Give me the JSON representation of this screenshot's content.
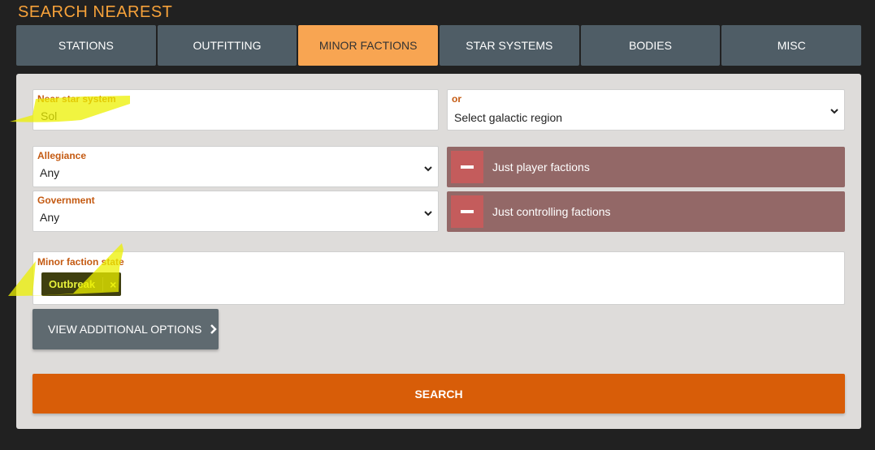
{
  "page": {
    "title": "SEARCH NEAREST"
  },
  "tabs": [
    {
      "label": "STATIONS",
      "active": false
    },
    {
      "label": "OUTFITTING",
      "active": false
    },
    {
      "label": "MINOR FACTIONS",
      "active": true
    },
    {
      "label": "STAR SYSTEMS",
      "active": false
    },
    {
      "label": "BODIES",
      "active": false
    },
    {
      "label": "MISC",
      "active": false
    }
  ],
  "form": {
    "near_system": {
      "label": "Near star system",
      "value": "Sol"
    },
    "region": {
      "label": "or",
      "value": "Select galactic region"
    },
    "allegiance": {
      "label": "Allegiance",
      "value": "Any"
    },
    "government": {
      "label": "Government",
      "value": "Any"
    },
    "player_factions": {
      "label": "Just player factions",
      "state": "off"
    },
    "controlling_factions": {
      "label": "Just controlling factions",
      "state": "off"
    },
    "faction_state": {
      "label": "Minor faction state",
      "tags": [
        "Outbreak"
      ],
      "remove_glyph": "×"
    },
    "more_options": {
      "label": "VIEW ADDITIONAL OPTIONS",
      "icon": "chevron-right-icon"
    },
    "search": {
      "label": "SEARCH"
    }
  },
  "colors": {
    "accent_orange": "#f7a23a",
    "search_button": "#d85d08",
    "toggle_bg": "#936867",
    "highlighter": "#ecf000"
  }
}
